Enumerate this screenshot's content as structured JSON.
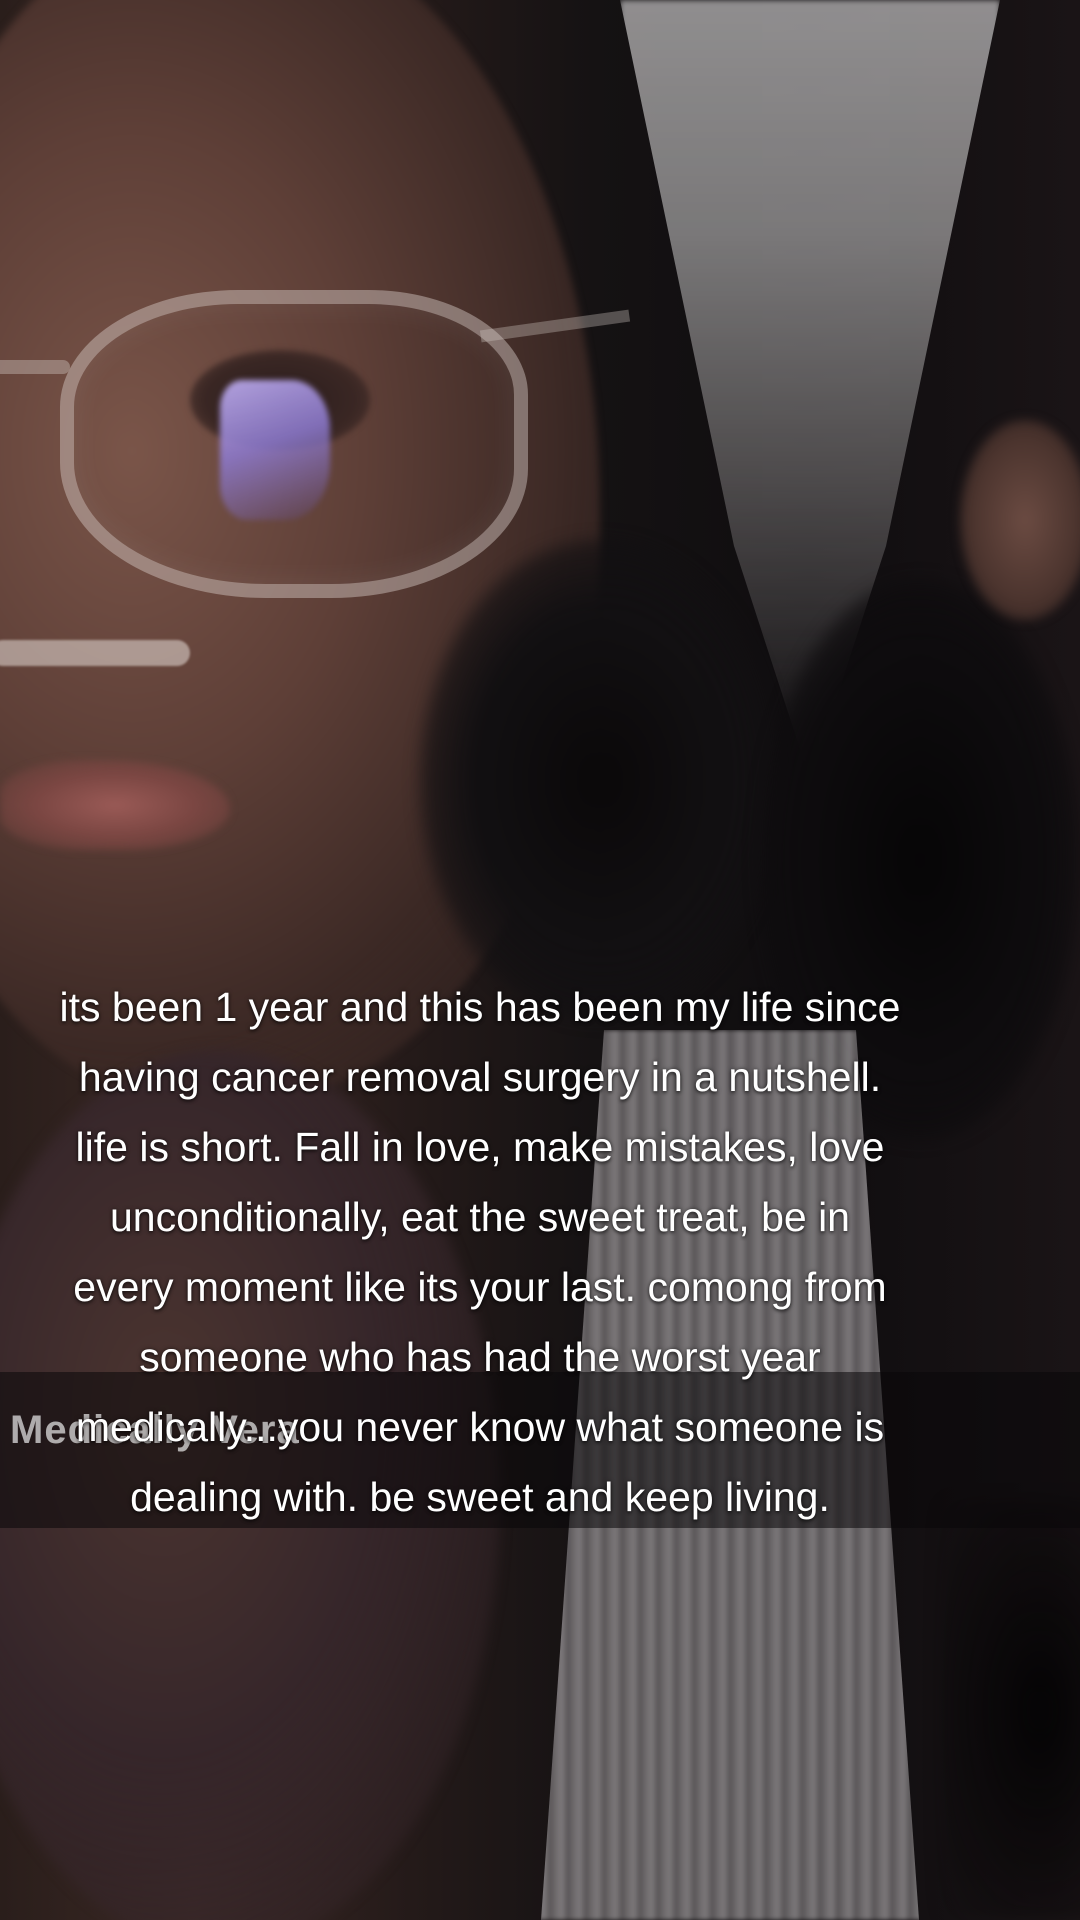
{
  "caption": {
    "lines": [
      "its been 1 year and this has been my life since",
      "having cancer removal surgery in a nutshell.",
      "life is short. Fall in love, make mistakes, love",
      "unconditionally, eat the sweet treat, be in",
      "every moment like its your last. comong from",
      "someone who has had the worst year",
      "medically...you never know what someone is",
      "dealing with. be sweet and keep living."
    ]
  },
  "overlay_tag": {
    "text": "Medically Vera"
  },
  "colors": {
    "caption_text": "#ffffff",
    "overlay_band": "#0a080a"
  }
}
